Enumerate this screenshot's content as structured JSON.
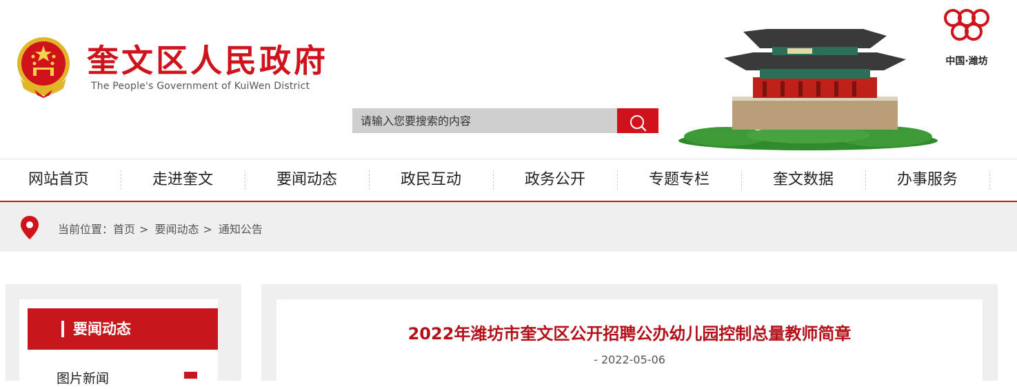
{
  "header": {
    "title": "奎文区人民政府",
    "subtitle": "The People's Government of KuiWen District",
    "city_label": "中国·潍坊",
    "search": {
      "placeholder": "请输入您要搜索的内容"
    },
    "accent_color": "#d0121b"
  },
  "nav": {
    "items": [
      "网站首页",
      "走进奎文",
      "要闻动态",
      "政民互动",
      "政务公开",
      "专题专栏",
      "奎文数据",
      "办事服务"
    ]
  },
  "breadcrumb": {
    "prefix": "当前位置：",
    "items": [
      "首页",
      "要闻动态",
      "通知公告"
    ],
    "separator": ">"
  },
  "sidebar": {
    "heading": "要闻动态",
    "items": [
      "图片新闻"
    ]
  },
  "article": {
    "title": "2022年潍坊市奎文区公开招聘公办幼儿园控制总量教师简章",
    "date": "- 2022-05-06"
  },
  "icons": {
    "emblem": "national-emblem-icon",
    "search": "search-icon",
    "location": "location-pin-icon",
    "city_logo": "weifang-kite-logo-icon"
  }
}
